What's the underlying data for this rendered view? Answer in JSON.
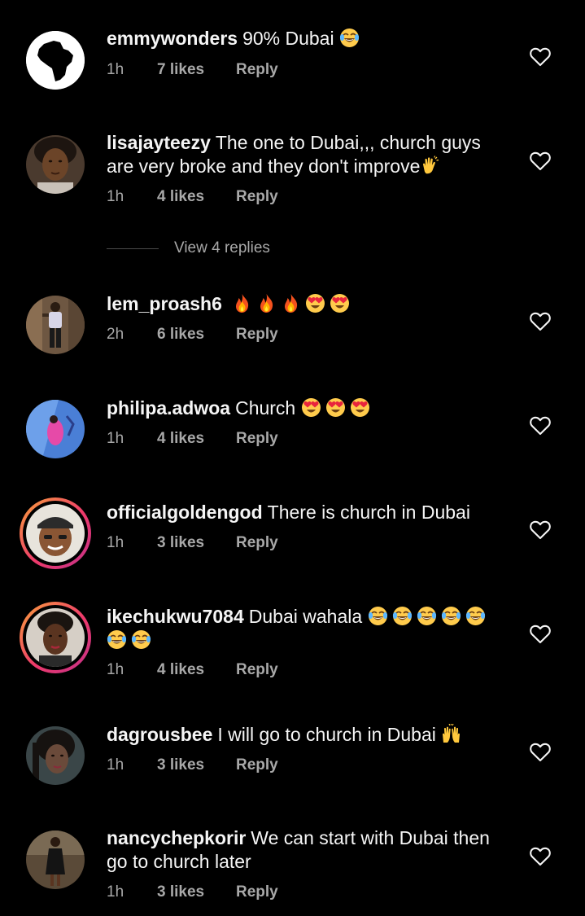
{
  "comments": [
    {
      "username": "emmywonders",
      "text": "90% Dubai",
      "emojis": [
        "tears-of-joy"
      ],
      "time": "1h",
      "likes": "7 likes",
      "reply": "Reply",
      "avatar": "africa-map",
      "story_ring": false
    },
    {
      "username": "lisajayteezy",
      "text": "The one to Dubai,,, church guys are very broke and they don't improve",
      "emojis": [
        "clapping-hands"
      ],
      "time": "1h",
      "likes": "4 likes",
      "reply": "Reply",
      "avatar": "woman-portrait",
      "story_ring": false
    },
    {
      "username": "lem_proash6",
      "text": "",
      "emojis": [
        "fire",
        "fire",
        "fire",
        "heart-eyes",
        "heart-eyes"
      ],
      "time": "2h",
      "likes": "6 likes",
      "reply": "Reply",
      "avatar": "full-body-photo",
      "story_ring": false
    },
    {
      "username": "philipa.adwoa",
      "text": "Church",
      "emojis": [
        "heart-eyes",
        "heart-eyes",
        "heart-eyes"
      ],
      "time": "1h",
      "likes": "4 likes",
      "reply": "Reply",
      "avatar": "blue-photo",
      "story_ring": false
    },
    {
      "username": "officialgoldengod",
      "text": "There is church in Dubai",
      "emojis": [],
      "time": "1h",
      "likes": "3 likes",
      "reply": "Reply",
      "avatar": "man-cap",
      "story_ring": true
    },
    {
      "username": "ikechukwu7084",
      "text": "Dubai wahala",
      "emojis": [
        "tears-of-joy",
        "tears-of-joy",
        "tears-of-joy",
        "tears-of-joy",
        "tears-of-joy",
        "tears-of-joy",
        "tears-of-joy"
      ],
      "time": "1h",
      "likes": "4 likes",
      "reply": "Reply",
      "avatar": "woman-selfie",
      "story_ring": true
    },
    {
      "username": "dagrousbee",
      "text": "I will go to church in Dubai",
      "emojis": [
        "raising-hands"
      ],
      "time": "1h",
      "likes": "3 likes",
      "reply": "Reply",
      "avatar": "woman-dark",
      "story_ring": false
    },
    {
      "username": "nancychepkorir",
      "text": "We can start with Dubai then go to church later",
      "emojis": [],
      "time": "1h",
      "likes": "3 likes",
      "reply": "Reply",
      "avatar": "standing-woman",
      "story_ring": false
    }
  ],
  "view_replies": "View 4 replies",
  "colors": {
    "background": "#000000",
    "text": "#f5f5f5",
    "secondary_text": "#a8a8a8",
    "story_ring_start": "#f9a33a",
    "story_ring_end": "#c1318a"
  },
  "icons": {
    "like": "heart-outline-icon"
  }
}
